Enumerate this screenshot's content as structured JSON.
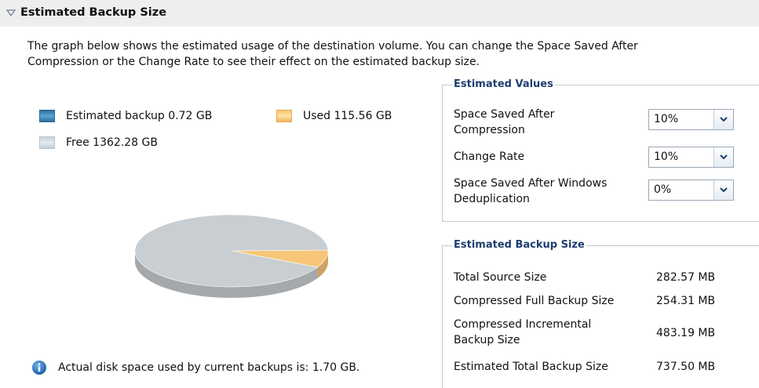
{
  "section": {
    "title": "Estimated Backup Size",
    "collapse_icon": "triangle-down-icon"
  },
  "intro": {
    "line1": "The graph below shows the estimated usage of the destination volume. You can change the Space Saved After",
    "line2": "Compression or the Change Rate to see their effect on the estimated backup size."
  },
  "legend": {
    "backup": "Estimated backup 0.72 GB",
    "used": "Used 115.56 GB",
    "free": "Free 1362.28 GB"
  },
  "chart_data": {
    "type": "pie",
    "labels": [
      "Estimated backup",
      "Used",
      "Free"
    ],
    "values": [
      0.72,
      115.56,
      1362.28
    ],
    "unit": "GB",
    "colors": [
      "#3b86b8",
      "#f7c678",
      "#c9ced2"
    ]
  },
  "info": {
    "icon": "info-icon",
    "text": "Actual disk space used by current backups is: 1.70 GB."
  },
  "estimated_values": {
    "title": "Estimated Values",
    "fields": [
      {
        "label_line1": "Space Saved After",
        "label_line2": "Compression",
        "value": "10%"
      },
      {
        "label_line1": "Change Rate",
        "label_line2": "",
        "value": "10%"
      },
      {
        "label_line1": "Space Saved After Windows",
        "label_line2": "Deduplication",
        "value": "0%"
      }
    ]
  },
  "estimated_backup_size": {
    "title": "Estimated Backup Size",
    "rows": [
      {
        "label_line1": "Total Source Size",
        "label_line2": "",
        "value": "282.57 MB"
      },
      {
        "label_line1": "Compressed Full Backup Size",
        "label_line2": "",
        "value": "254.31 MB"
      },
      {
        "label_line1": "Compressed Incremental",
        "label_line2": "Backup Size",
        "value": "483.19 MB"
      },
      {
        "label_line1": "Estimated Total Backup Size",
        "label_line2": "",
        "value": "737.50 MB"
      }
    ]
  }
}
